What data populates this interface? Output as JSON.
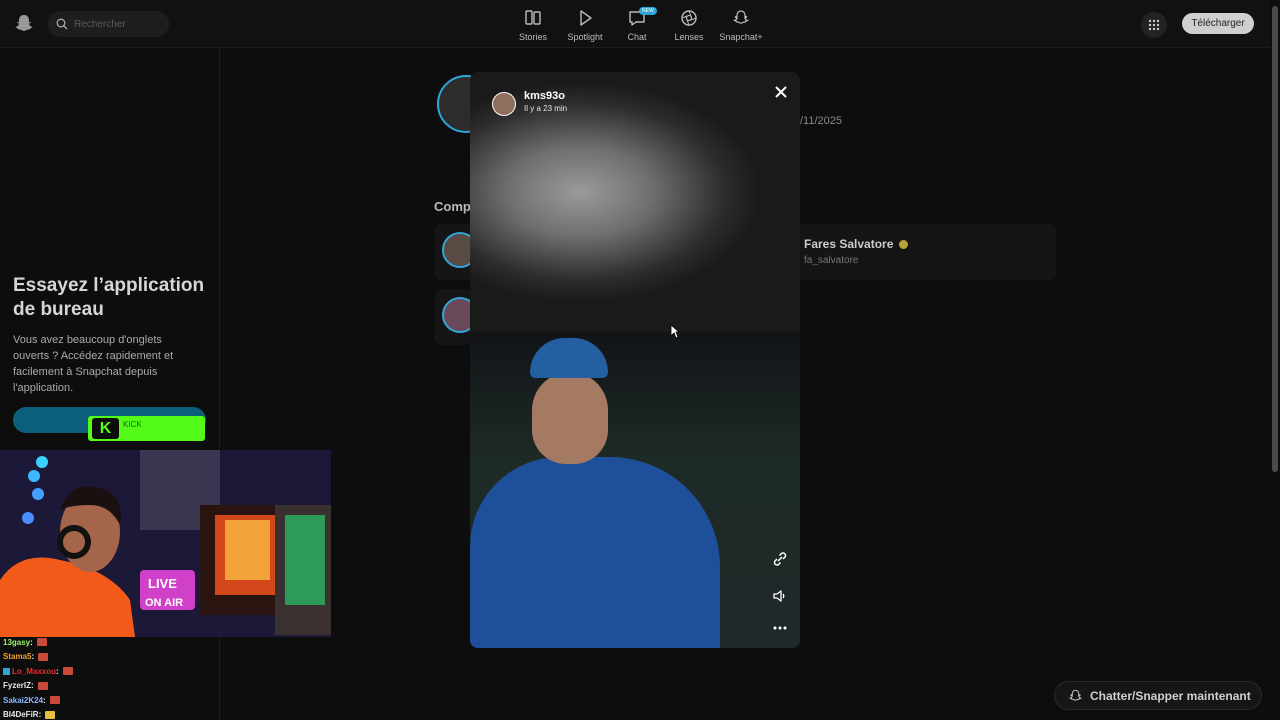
{
  "topbar": {
    "search_placeholder": "Rechercher",
    "nav": [
      {
        "label": "Stories",
        "icon": "stories-icon"
      },
      {
        "label": "Spotlight",
        "icon": "play-icon"
      },
      {
        "label": "Chat",
        "icon": "chat-icon",
        "badge": "NEW"
      },
      {
        "label": "Lenses",
        "icon": "lens-icon"
      },
      {
        "label": "Snapchat+",
        "icon": "snapchat-plus-icon"
      }
    ],
    "download_label": "Télécharger"
  },
  "sidebar": {
    "promo_title": "Essayez l’application de bureau",
    "promo_text": "Vous avez beaucoup d'onglets ouverts ? Accédez rapidement et facilement à Snapchat depuis l'application."
  },
  "kick": {
    "logo": "K",
    "text": "KICK"
  },
  "background": {
    "date": "/11/2025",
    "section_heading": "Compt",
    "suggested": {
      "name": "Fares Salvatore",
      "username": "fa_salvatore"
    }
  },
  "story": {
    "username": "kms93o",
    "time": "Il y a 23 min"
  },
  "stream_chat": [
    {
      "user": "13gasy",
      "color": "#9bf46a",
      "sep": " :"
    },
    {
      "user": "Stama5",
      "color": "#f0a030",
      "sep": " :"
    },
    {
      "user": "Lo_Maxxou",
      "color": "#e03030",
      "sep": " :"
    },
    {
      "user": "FyzerIZ",
      "color": "#e8e8e8",
      "sep": " :"
    },
    {
      "user": "Sakai2K24",
      "color": "#8fb8ff",
      "sep": " :"
    },
    {
      "user": "Bl4DeFiR",
      "color": "#e8e8e8",
      "sep": " :"
    }
  ],
  "chat_now_label": "Chatter/Snapper maintenant"
}
